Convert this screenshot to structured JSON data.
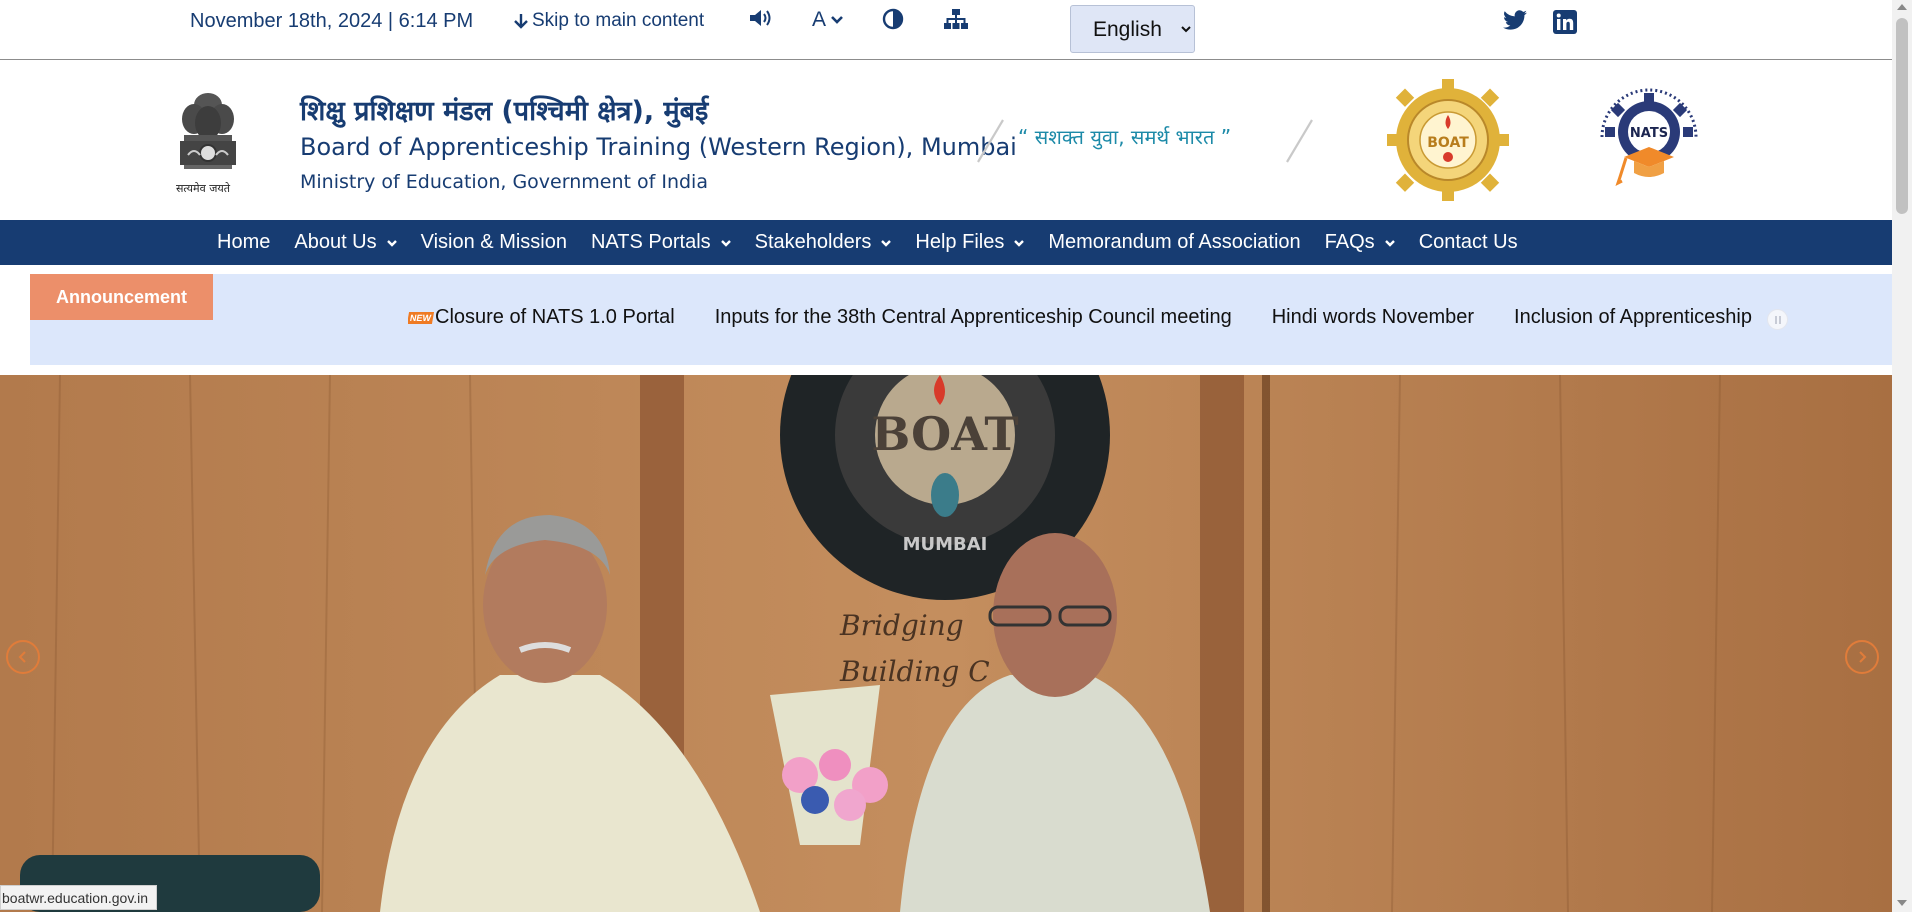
{
  "topbar": {
    "datetime": "November 18th, 2024 | 6:14 PM",
    "skip_label": "Skip to main content",
    "font_size_label": "A",
    "language": {
      "selected": "English",
      "options": [
        "English"
      ]
    },
    "icons": [
      "volume-icon",
      "font-size-icon",
      "contrast-icon",
      "sitemap-icon",
      "twitter-icon",
      "linkedin-icon"
    ]
  },
  "header": {
    "title_hindi": "शिक्षु प्रशिक्षण मंडल (पश्चिमी क्षेत्र), मुंबई",
    "title_english": "Board of Apprenticeship Training (Western Region), Mumbai",
    "ministry": "Ministry of Education, Government of India",
    "emblem_text": "सत्यमेव जयते",
    "slogan": "“ सशक्त युवा, समर्थ भारत ”",
    "boat_logo_text": "BOAT",
    "nats_logo_text": "NATS"
  },
  "nav": {
    "items": [
      {
        "label": "Home",
        "dropdown": false
      },
      {
        "label": "About Us",
        "dropdown": true
      },
      {
        "label": "Vision & Mission",
        "dropdown": false
      },
      {
        "label": "NATS Portals",
        "dropdown": true
      },
      {
        "label": "Stakeholders",
        "dropdown": true
      },
      {
        "label": "Help Files",
        "dropdown": true
      },
      {
        "label": "Memorandum of Association",
        "dropdown": false
      },
      {
        "label": "FAQs",
        "dropdown": true
      },
      {
        "label": "Contact Us",
        "dropdown": false
      }
    ]
  },
  "announcement": {
    "tag": "Announcement",
    "new_badge": "NEW",
    "items": [
      "Closure of NATS 1.0 Portal",
      "Inputs for the 38th Central Apprenticeship Council meeting",
      "Hindi words November",
      "Inclusion of Apprenticeship"
    ]
  },
  "hero": {
    "sign_text": "BOAT",
    "sign_sub": "MUMBAI",
    "wall_text_1": "Bridging",
    "wall_text_2": "Building C"
  },
  "status_url": "boatwr.education.gov.in",
  "colors": {
    "navy": "#173c72",
    "announcement_bg": "#dce7fb",
    "announcement_tag": "#ec8f6a",
    "slider_arrow": "#e07c3a"
  }
}
